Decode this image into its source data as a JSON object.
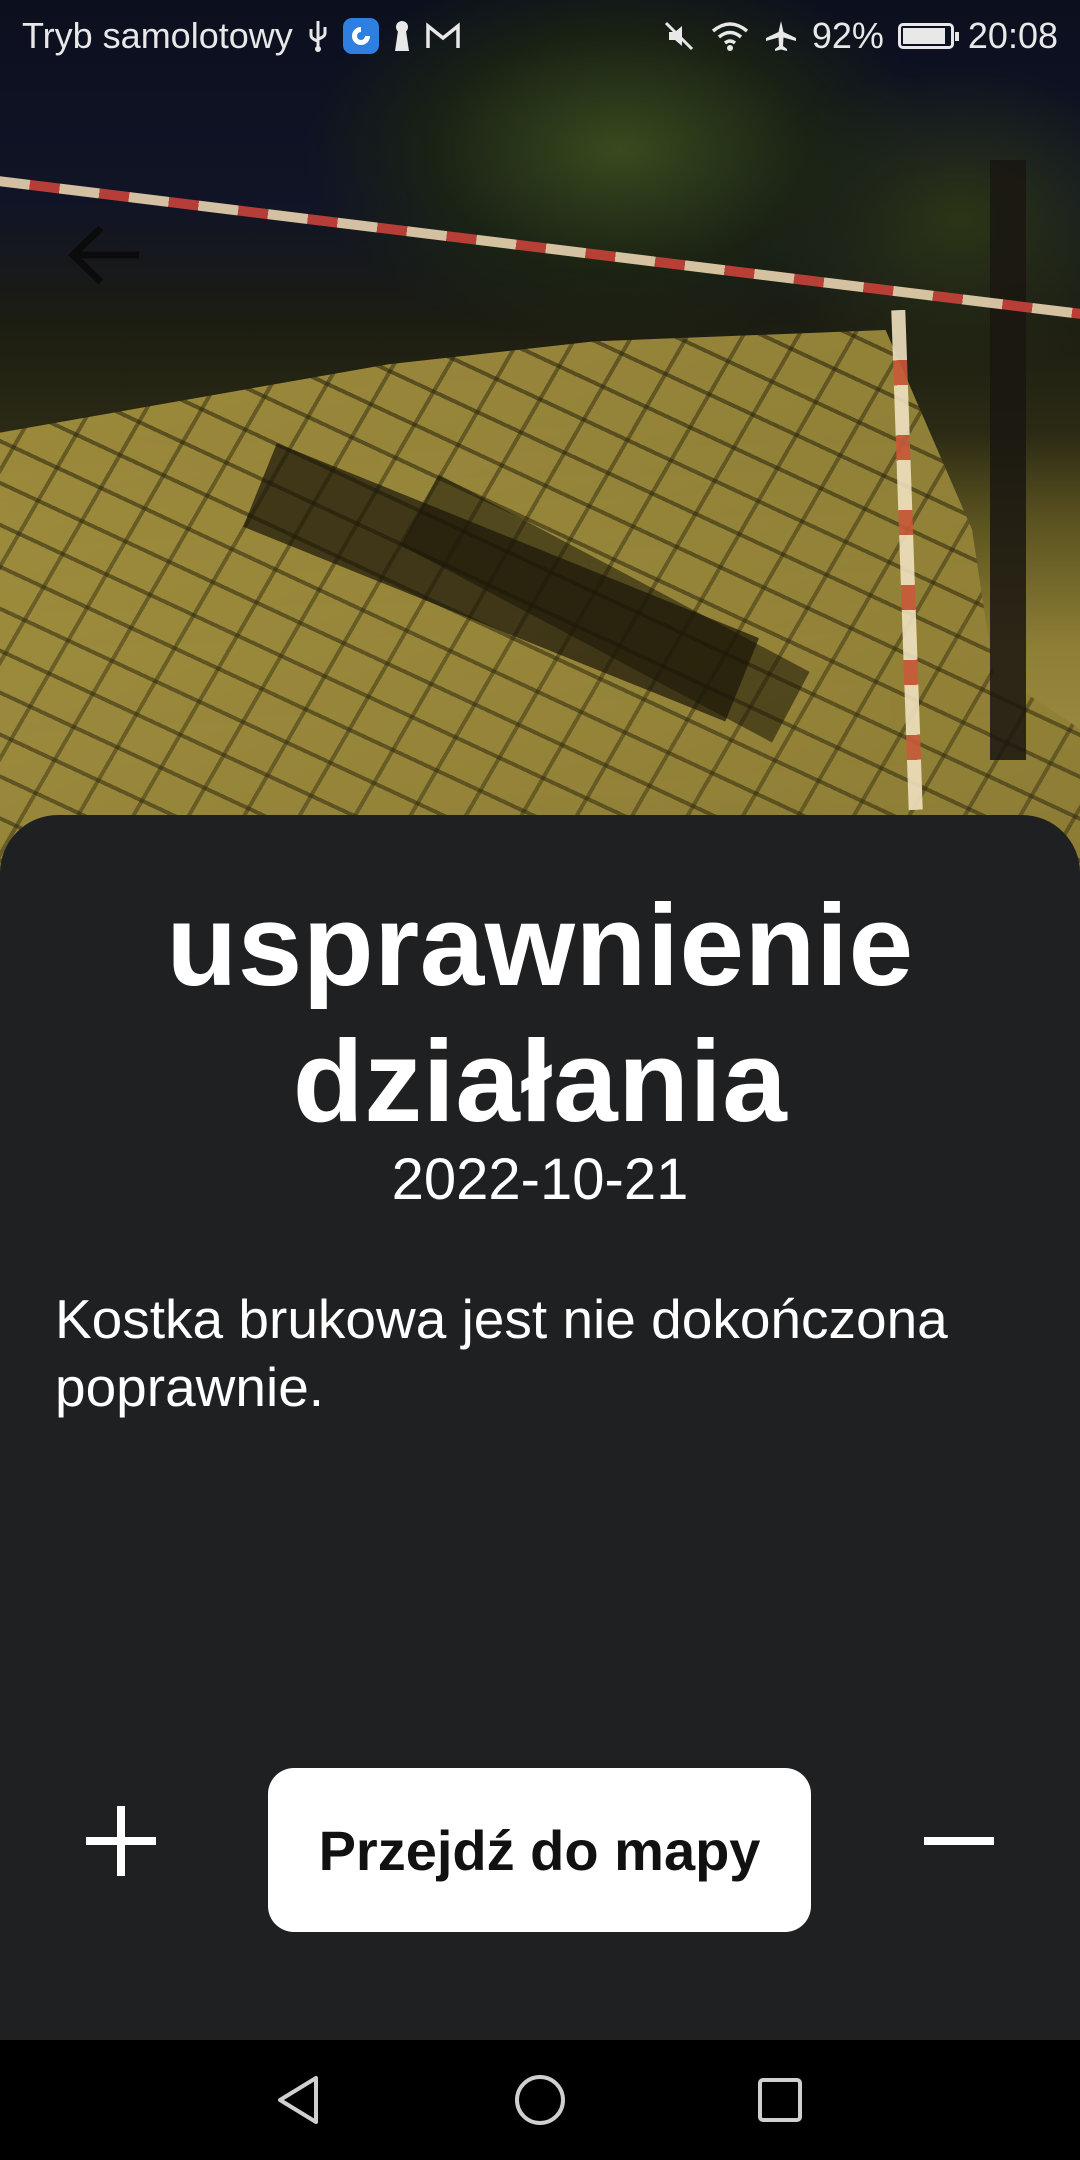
{
  "status_bar": {
    "left_text": "Tryb samolotowy",
    "battery_text": "92%",
    "battery_level": 0.92,
    "time": "20:08",
    "icons": [
      "usb-icon",
      "app-notification-icon",
      "keyhole-icon",
      "gmail-icon",
      "mute-icon",
      "wifi-icon",
      "airplane-icon",
      "battery-icon"
    ]
  },
  "report": {
    "title": "usprawnienie działania",
    "date": "2022-10-21",
    "description": "Kostka brukowa jest nie dokończona poprawnie."
  },
  "actions": {
    "map_button_label": "Przejdź do mapy",
    "plus_icon": "plus-icon",
    "minus_icon": "minus-icon",
    "back_icon": "arrow-left-icon"
  },
  "nav_bar": {
    "icons": [
      "back-triangle-icon",
      "home-circle-icon",
      "recents-square-icon"
    ]
  },
  "colors": {
    "sheet": "#1f2022",
    "button_bg": "#ffffff",
    "text": "#ffffff"
  }
}
